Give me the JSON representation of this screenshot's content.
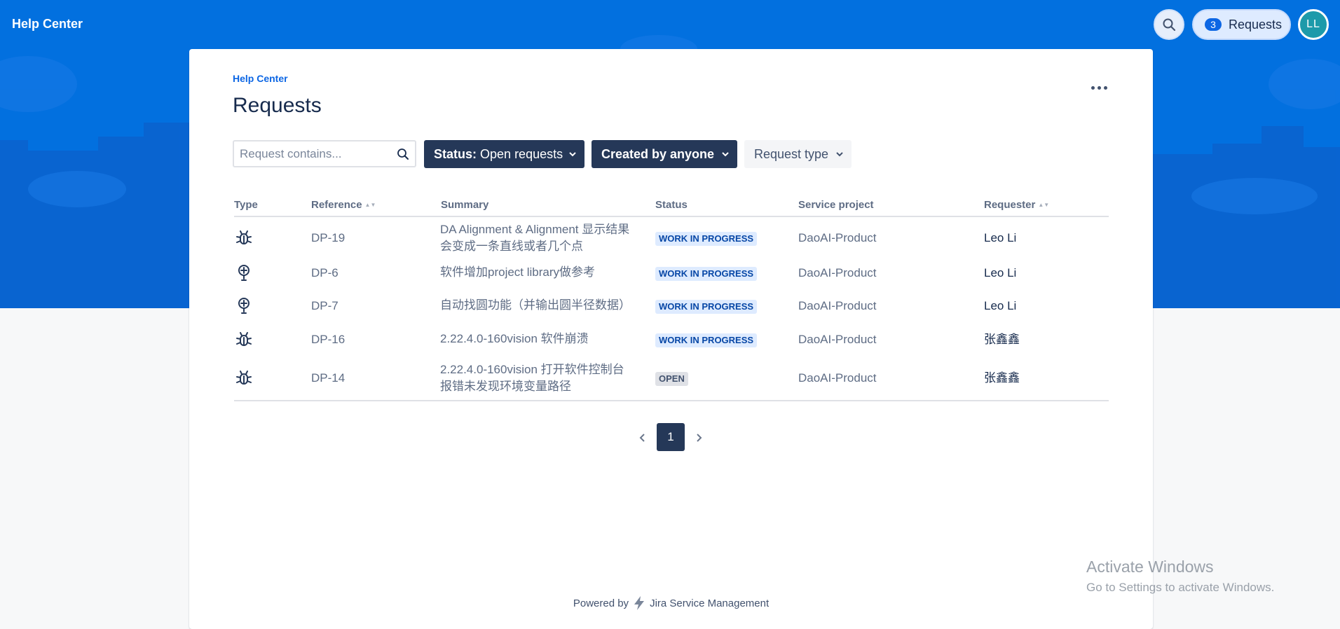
{
  "header": {
    "brand": "Help Center",
    "requests_count": "3",
    "requests_label": "Requests",
    "avatar_initials": "LL",
    "icons": {
      "search": "search-icon"
    }
  },
  "page": {
    "breadcrumb": "Help Center",
    "title": "Requests",
    "search_placeholder": "Request contains..."
  },
  "filters": {
    "status_key": "Status:",
    "status_value": "Open requests",
    "created_by": "Created by anyone",
    "request_type": "Request type"
  },
  "table": {
    "columns": [
      "Type",
      "Reference",
      "Summary",
      "Status",
      "Service project",
      "Requester"
    ],
    "rows": [
      {
        "type_icon": "bug-icon",
        "reference": "DP-19",
        "summary_line1": "DA Alignment & Alignment 显示结果",
        "summary_line2": "会变成一条直线或者几个点",
        "status": "WORK IN PROGRESS",
        "project": "DaoAI-Product",
        "requester": "Leo Li"
      },
      {
        "type_icon": "lightbulb-icon",
        "reference": "DP-6",
        "summary_line1": "软件增加project library做参考",
        "summary_line2": "",
        "status": "WORK IN PROGRESS",
        "project": "DaoAI-Product",
        "requester": "Leo Li"
      },
      {
        "type_icon": "lightbulb-icon",
        "reference": "DP-7",
        "summary_line1": "自动找圆功能（并输出圆半径数据）",
        "summary_line2": "",
        "status": "WORK IN PROGRESS",
        "project": "DaoAI-Product",
        "requester": "Leo Li"
      },
      {
        "type_icon": "bug-icon",
        "reference": "DP-16",
        "summary_line1": "2.22.4.0-160vision 软件崩溃",
        "summary_line2": "",
        "status": "WORK IN PROGRESS",
        "project": "DaoAI-Product",
        "requester": "张鑫鑫"
      },
      {
        "type_icon": "bug-icon",
        "reference": "DP-14",
        "summary_line1": "2.22.4.0-160vision 打开软件控制台",
        "summary_line2": "报错未发现环境变量路径",
        "status": "OPEN",
        "project": "DaoAI-Product",
        "requester": "张鑫鑫"
      }
    ]
  },
  "pagination": {
    "current": "1"
  },
  "footer": {
    "powered_by": "Powered by",
    "product": "Jira Service Management"
  },
  "watermark": {
    "line1": "Activate Windows",
    "line2": "Go to Settings to activate Windows."
  },
  "colors": {
    "banner": "#0270df",
    "dark_button": "#253858",
    "link": "#0c66e4",
    "lozenge_wip_bg": "#deebff",
    "lozenge_wip_text": "#0747a6"
  }
}
